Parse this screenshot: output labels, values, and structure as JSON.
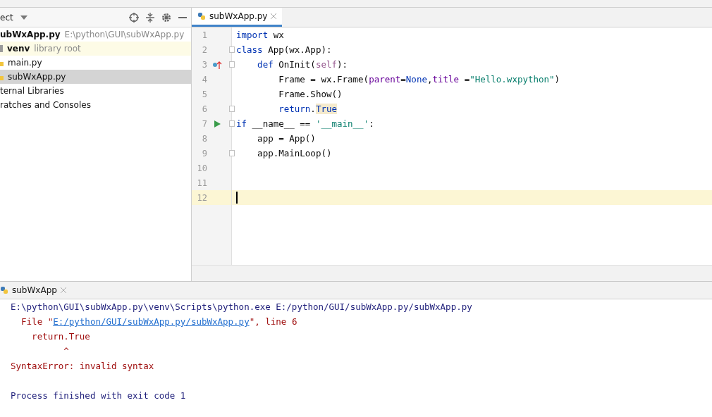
{
  "project_panel": {
    "title": "ect",
    "items": [
      {
        "kind": "root",
        "label": "ubWxApp.py",
        "path": "E:\\python\\GUI\\subWxApp.py",
        "selected": false
      },
      {
        "kind": "folder",
        "label": "venv",
        "note": "library root",
        "selected": false
      },
      {
        "kind": "file",
        "label": "main.py",
        "selected": false
      },
      {
        "kind": "file",
        "label": "subWxApp.py",
        "selected": true
      },
      {
        "kind": "plain",
        "label": "ternal Libraries",
        "selected": false
      },
      {
        "kind": "plain",
        "label": "ratches and Consoles",
        "selected": false
      }
    ]
  },
  "editor": {
    "tabs": [
      {
        "label": "subWxApp.py",
        "selected": true
      }
    ],
    "lines": [
      {
        "number": "1",
        "kind": "plain",
        "fold": false,
        "current": false,
        "segments": [
          {
            "kind": "kw",
            "text": "import"
          },
          {
            "kind": "plain",
            "text": " wx"
          }
        ]
      },
      {
        "number": "2",
        "kind": "plain",
        "fold": true,
        "current": false,
        "segments": [
          {
            "kind": "kw",
            "text": "class"
          },
          {
            "kind": "plain",
            "text": " App(wx.App):"
          }
        ]
      },
      {
        "number": "3",
        "kind": "override",
        "fold": true,
        "current": false,
        "segments": [
          {
            "kind": "kw",
            "text": "    def"
          },
          {
            "kind": "plain",
            "text": " OnInit("
          },
          {
            "kind": "self",
            "text": "self"
          },
          {
            "kind": "plain",
            "text": "):"
          }
        ]
      },
      {
        "number": "4",
        "kind": "plain",
        "fold": false,
        "current": false,
        "segments": [
          {
            "kind": "plain",
            "text": "        Frame = wx.Frame("
          },
          {
            "kind": "param",
            "text": "parent"
          },
          {
            "kind": "plain",
            "text": "="
          },
          {
            "kind": "kw",
            "text": "None"
          },
          {
            "kind": "plain",
            "text": ","
          },
          {
            "kind": "param",
            "text": "title"
          },
          {
            "kind": "plain",
            "text": " ="
          },
          {
            "kind": "str",
            "text": "\"Hello.wxpython\""
          },
          {
            "kind": "plain",
            "text": ")"
          }
        ]
      },
      {
        "number": "5",
        "kind": "plain",
        "fold": false,
        "current": false,
        "segments": [
          {
            "kind": "plain",
            "text": "        Frame.Show()"
          }
        ]
      },
      {
        "number": "6",
        "kind": "plain",
        "fold": true,
        "current": false,
        "segments": [
          {
            "kind": "kw",
            "text": "        return"
          },
          {
            "kind": "plain",
            "text": "."
          },
          {
            "kind": "hl",
            "text": "True"
          }
        ]
      },
      {
        "number": "7",
        "kind": "run",
        "fold": true,
        "current": false,
        "segments": [
          {
            "kind": "kw",
            "text": "if"
          },
          {
            "kind": "plain",
            "text": " __name__ == "
          },
          {
            "kind": "str",
            "text": "'__main__'"
          },
          {
            "kind": "plain",
            "text": ":"
          }
        ]
      },
      {
        "number": "8",
        "kind": "plain",
        "fold": false,
        "current": false,
        "segments": [
          {
            "kind": "plain",
            "text": "    app = App()"
          }
        ]
      },
      {
        "number": "9",
        "kind": "plain",
        "fold": true,
        "current": false,
        "segments": [
          {
            "kind": "plain",
            "text": "    app.MainLoop()"
          }
        ]
      },
      {
        "number": "10",
        "kind": "plain",
        "fold": false,
        "current": false
      },
      {
        "number": "11",
        "kind": "plain",
        "fold": false,
        "current": false
      },
      {
        "number": "12",
        "kind": "plain",
        "fold": false,
        "current": true
      }
    ]
  },
  "run_panel": {
    "tabs": [
      {
        "label": "subWxApp"
      }
    ],
    "lines": [
      {
        "segments": [
          {
            "kind": "cmd",
            "text": "E:\\python\\GUI\\subWxApp.py\\venv\\Scripts\\python.exe E:/python/GUI/subWxApp.py/subWxApp.py"
          }
        ]
      },
      {
        "segments": [
          {
            "kind": "err",
            "text": "  File \""
          },
          {
            "kind": "link",
            "text": "E:/python/GUI/subWxApp.py/subWxApp.py"
          },
          {
            "kind": "err",
            "text": "\", line 6"
          }
        ]
      },
      {
        "segments": [
          {
            "kind": "err",
            "text": "    return.True"
          }
        ]
      },
      {
        "segments": [
          {
            "kind": "err",
            "text": "          ^"
          }
        ]
      },
      {
        "segments": [
          {
            "kind": "err",
            "text": "SyntaxError: invalid syntax"
          }
        ]
      },
      {
        "spaced": true,
        "segments": [
          {
            "kind": "cmd",
            "text": "Process finished with exit code 1"
          }
        ]
      }
    ]
  }
}
